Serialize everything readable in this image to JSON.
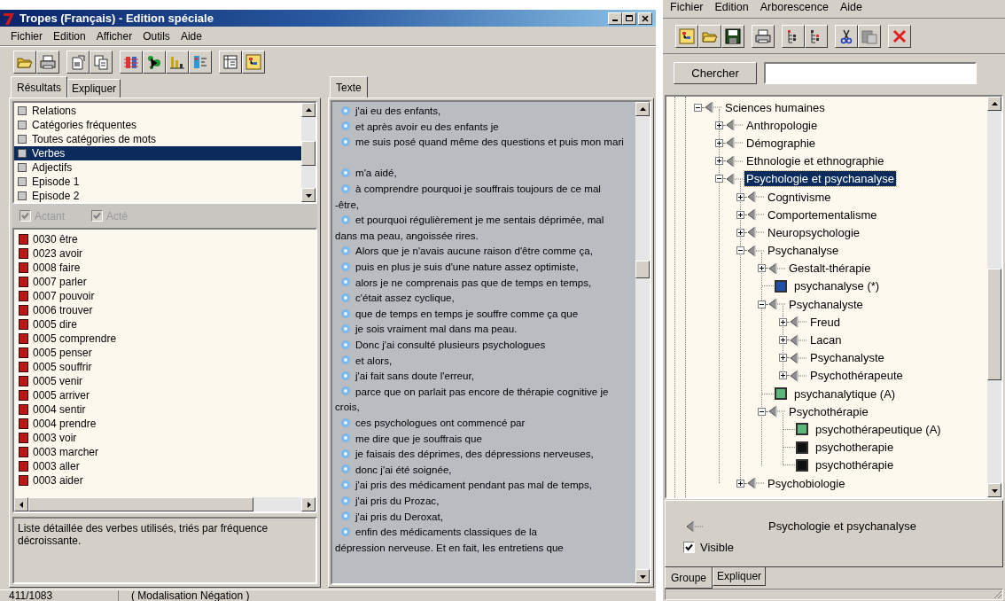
{
  "left_window": {
    "title": "Tropes (Français) - Edition spéciale",
    "menu": [
      "Fichier",
      "Edition",
      "Afficher",
      "Outils",
      "Aide"
    ],
    "results_tabs": [
      {
        "label": "Résultats",
        "selected": true
      },
      {
        "label": "Expliquer",
        "selected": false
      }
    ],
    "categories": [
      {
        "label": "Relations",
        "selected": false
      },
      {
        "label": "Catégories fréquentes",
        "selected": false
      },
      {
        "label": "Toutes catégories de mots",
        "selected": false
      },
      {
        "label": "Verbes",
        "selected": true
      },
      {
        "label": "Adjectifs",
        "selected": false
      },
      {
        "label": "Episode 1",
        "selected": false
      },
      {
        "label": "Episode 2",
        "selected": false
      }
    ],
    "filters": [
      {
        "label": "Actant",
        "checked": true,
        "disabled": true
      },
      {
        "label": "Acté",
        "checked": true,
        "disabled": true
      }
    ],
    "verbs": [
      "0030 être",
      "0023 avoir",
      "0008 faire",
      "0007 parler",
      "0007 pouvoir",
      "0006 trouver",
      "0005 dire",
      "0005 comprendre",
      "0005 penser",
      "0005 souffrir",
      "0005 venir",
      "0005 arriver",
      "0004 sentir",
      "0004 prendre",
      "0003 voir",
      "0003 marcher",
      "0003 aller",
      "0003 aider"
    ],
    "description": "Liste détaillée des verbes utilisés, triés par fréquence décroissante.",
    "text_tabs": [
      {
        "label": "Texte",
        "selected": true
      }
    ],
    "text_lines": [
      {
        "kind": "segment",
        "text": "j'ai eu des enfants,"
      },
      {
        "kind": "segment",
        "text": "et après avoir eu des enfants je"
      },
      {
        "kind": "segment",
        "text": "me suis posé quand même des questions et puis mon mari"
      },
      {
        "kind": "blank"
      },
      {
        "kind": "segment",
        "text": "m'a aidé,"
      },
      {
        "kind": "segment",
        "text": "à comprendre pourquoi je souffrais toujours de ce mal"
      },
      {
        "kind": "continuation",
        "text": "-être,"
      },
      {
        "kind": "segment",
        "text": "et pourquoi régulièrement je me sentais déprimée, mal"
      },
      {
        "kind": "continuation",
        "text": "dans ma peau, angoissée rires."
      },
      {
        "kind": "segment",
        "text": "Alors que je n'avais aucune raison d'être comme ça,"
      },
      {
        "kind": "segment",
        "text": "puis en plus je suis d'une nature assez optimiste,"
      },
      {
        "kind": "segment",
        "text": "alors je ne comprenais pas que de temps en temps,"
      },
      {
        "kind": "segment",
        "text": "c'était assez cyclique,"
      },
      {
        "kind": "segment",
        "text": "que de temps en temps je souffre comme ça que"
      },
      {
        "kind": "segment",
        "text": "je sois vraiment mal dans ma peau."
      },
      {
        "kind": "segment",
        "text": "Donc j'ai consulté plusieurs psychologues"
      },
      {
        "kind": "segment",
        "text": "et alors,"
      },
      {
        "kind": "segment",
        "text": "j'ai fait sans doute l'erreur,"
      },
      {
        "kind": "segment",
        "text": "parce que on parlait pas encore de thérapie cognitive je"
      },
      {
        "kind": "continuation",
        "text": "crois,"
      },
      {
        "kind": "segment",
        "text": "ces psychologues ont commencé par"
      },
      {
        "kind": "segment",
        "text": "me dire que je souffrais que"
      },
      {
        "kind": "segment",
        "text": "je faisais des déprimes, des dépressions nerveuses,"
      },
      {
        "kind": "segment",
        "text": "donc j'ai été soignée,"
      },
      {
        "kind": "segment",
        "text": "j'ai pris des médicament pendant pas mal de temps,"
      },
      {
        "kind": "segment",
        "text": "j'ai pris du Prozac,"
      },
      {
        "kind": "segment",
        "text": "j'ai pris du Deroxat,"
      },
      {
        "kind": "segment",
        "text": "enfin des médicaments classiques de la"
      },
      {
        "kind": "continuation",
        "text": "dépression nerveuse. Et en fait, les entretiens que"
      }
    ],
    "status_bar": [
      "411/1083",
      "( Modalisation Négation )"
    ]
  },
  "right_window": {
    "menu": [
      "Fichier",
      "Edition",
      "Arborescence",
      "Aide"
    ],
    "search": {
      "button": "Chercher"
    },
    "tree": [
      {
        "kind": "group",
        "label": "Sciences humaines",
        "expanded": true,
        "selected": false,
        "children": [
          {
            "kind": "group",
            "label": "Anthropologie",
            "expanded": false,
            "selected": false
          },
          {
            "kind": "group",
            "label": "Démographie",
            "expanded": false,
            "selected": false
          },
          {
            "kind": "group",
            "label": "Ethnologie et ethnographie",
            "expanded": false,
            "selected": false
          },
          {
            "kind": "group",
            "label": "Psychologie et psychanalyse",
            "expanded": true,
            "selected": true,
            "children": [
              {
                "kind": "group",
                "label": "Cogntivisme",
                "expanded": false,
                "selected": false
              },
              {
                "kind": "group",
                "label": "Comportementalisme",
                "expanded": false,
                "selected": false
              },
              {
                "kind": "group",
                "label": "Neuropsychologie",
                "expanded": false,
                "selected": false
              },
              {
                "kind": "group",
                "label": "Psychanalyse",
                "expanded": true,
                "selected": false,
                "children": [
                  {
                    "kind": "group",
                    "label": "Gestalt-thérapie",
                    "expanded": false,
                    "selected": false
                  },
                  {
                    "kind": "word",
                    "label": "psychanalyse (*)",
                    "color": "#1f4fa8",
                    "selected": false
                  },
                  {
                    "kind": "group",
                    "label": "Psychanalyste",
                    "expanded": true,
                    "selected": false,
                    "children": [
                      {
                        "kind": "group",
                        "label": "Freud",
                        "expanded": false,
                        "selected": false
                      },
                      {
                        "kind": "group",
                        "label": "Lacan",
                        "expanded": false,
                        "selected": false
                      },
                      {
                        "kind": "group",
                        "label": "Psychanalyste",
                        "expanded": false,
                        "selected": false
                      },
                      {
                        "kind": "group",
                        "label": "Psychothérapeute",
                        "expanded": false,
                        "selected": false
                      }
                    ]
                  },
                  {
                    "kind": "word",
                    "label": "psychanalytique (A)",
                    "color": "#5cb87a",
                    "selected": false
                  },
                  {
                    "kind": "group",
                    "label": "Psychothérapie",
                    "expanded": true,
                    "selected": false,
                    "children": [
                      {
                        "kind": "word",
                        "label": "psychothérapeutique (A)",
                        "color": "#5cb87a",
                        "selected": false
                      },
                      {
                        "kind": "word",
                        "label": "psychotherapie",
                        "color": "#101010",
                        "selected": false
                      },
                      {
                        "kind": "word",
                        "label": "psychothérapie",
                        "color": "#101010",
                        "selected": false
                      }
                    ]
                  }
                ]
              },
              {
                "kind": "group",
                "label": "Psychobiologie",
                "expanded": false,
                "selected": false
              }
            ]
          }
        ]
      }
    ],
    "details": {
      "label": "Psychologie et psychanalyse",
      "visible": {
        "label": "Visible",
        "checked": true
      }
    },
    "tabs": [
      {
        "label": "Groupe",
        "selected": true
      },
      {
        "label": "Expliquer",
        "selected": false
      }
    ]
  }
}
